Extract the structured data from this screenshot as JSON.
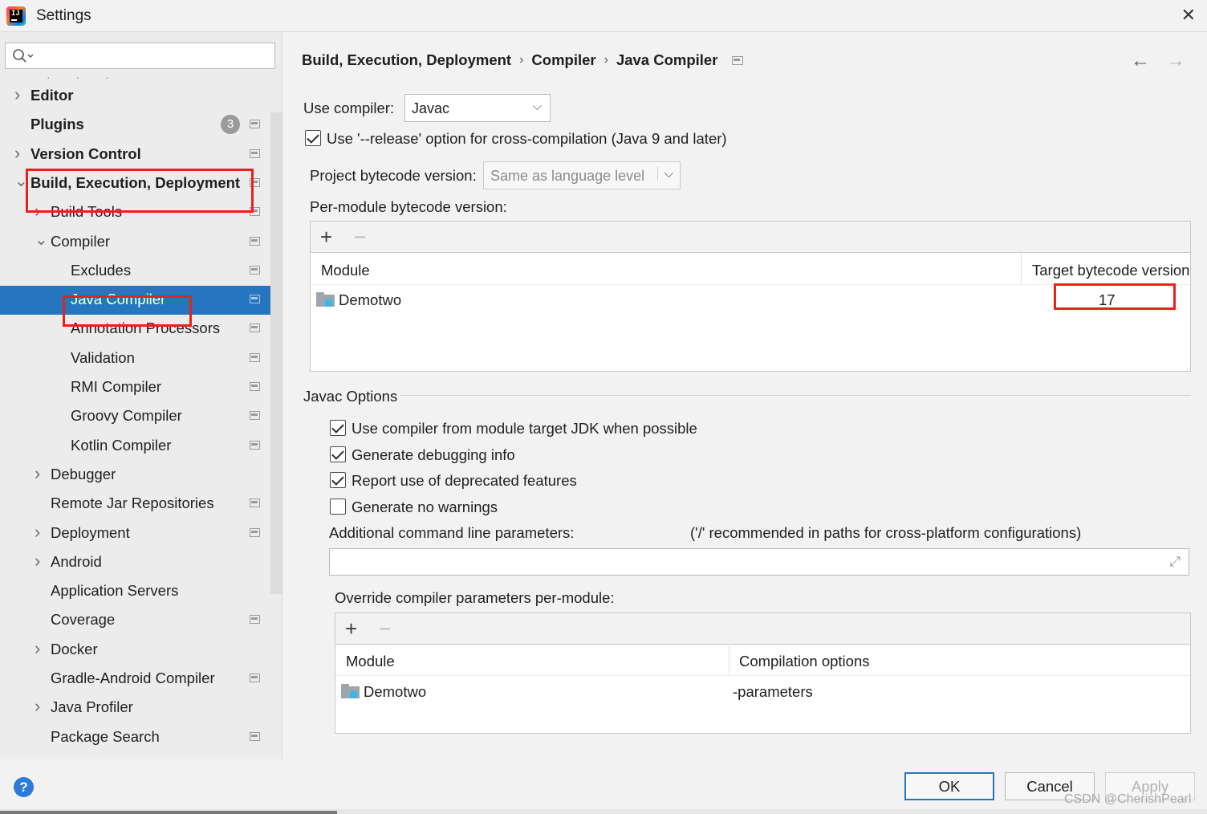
{
  "window": {
    "title": "Settings",
    "close_label": "✕"
  },
  "search": {
    "placeholder": "",
    "value": ""
  },
  "sidebar": {
    "items": [
      {
        "label": "Editor",
        "indent": 0,
        "bold": true,
        "arrow": "right"
      },
      {
        "label": "Plugins",
        "indent": 0,
        "bold": true,
        "badge": "3"
      },
      {
        "label": "Version Control",
        "indent": 0,
        "bold": true,
        "arrow": "right"
      },
      {
        "label": "Build, Execution, Deployment",
        "indent": 0,
        "bold": true,
        "arrow": "down"
      },
      {
        "label": "Build Tools",
        "indent": 1,
        "arrow": "right"
      },
      {
        "label": "Compiler",
        "indent": 1,
        "arrow": "down"
      },
      {
        "label": "Excludes",
        "indent": 2
      },
      {
        "label": "Java Compiler",
        "indent": 2,
        "selected": true
      },
      {
        "label": "Annotation Processors",
        "indent": 2
      },
      {
        "label": "Validation",
        "indent": 2
      },
      {
        "label": "RMI Compiler",
        "indent": 2
      },
      {
        "label": "Groovy Compiler",
        "indent": 2
      },
      {
        "label": "Kotlin Compiler",
        "indent": 2
      },
      {
        "label": "Debugger",
        "indent": 1,
        "arrow": "right"
      },
      {
        "label": "Remote Jar Repositories",
        "indent": 1
      },
      {
        "label": "Deployment",
        "indent": 1,
        "arrow": "right"
      },
      {
        "label": "Android",
        "indent": 1,
        "arrow": "right"
      },
      {
        "label": "Application Servers",
        "indent": 1
      },
      {
        "label": "Coverage",
        "indent": 1
      },
      {
        "label": "Docker",
        "indent": 1,
        "arrow": "right"
      },
      {
        "label": "Gradle-Android Compiler",
        "indent": 1
      },
      {
        "label": "Java Profiler",
        "indent": 1,
        "arrow": "right"
      },
      {
        "label": "Package Search",
        "indent": 1
      }
    ]
  },
  "breadcrumb": [
    "Build, Execution, Deployment",
    "Compiler",
    "Java Compiler"
  ],
  "nav": {
    "back": "←",
    "forward": "→"
  },
  "use_compiler": {
    "label": "Use compiler:",
    "value": "Javac"
  },
  "release_option": {
    "label": "Use '--release' option for cross-compilation (Java 9 and later)",
    "checked": true
  },
  "project_bytecode": {
    "label": "Project bytecode version:",
    "placeholder": "Same as language level"
  },
  "per_module": {
    "label": "Per-module bytecode version:",
    "columns": [
      "Module",
      "Target bytecode version"
    ],
    "rows": [
      {
        "module": "Demotwo",
        "version": "17"
      }
    ]
  },
  "javac_options": {
    "title": "Javac Options",
    "checkboxes": [
      {
        "label": "Use compiler from module target JDK when possible",
        "checked": true
      },
      {
        "label": "Generate debugging info",
        "checked": true
      },
      {
        "label": "Report use of deprecated features",
        "checked": true
      },
      {
        "label": "Generate no warnings",
        "checked": false
      }
    ],
    "additional_params_label": "Additional command line parameters:",
    "additional_params_hint": "('/' recommended in paths for cross-platform configurations)",
    "additional_params_value": "",
    "override_label": "Override compiler parameters per-module:",
    "override_columns": [
      "Module",
      "Compilation options"
    ],
    "override_rows": [
      {
        "module": "Demotwo",
        "options": "-parameters"
      }
    ]
  },
  "toolbar": {
    "add": "+",
    "remove": "−"
  },
  "buttons": {
    "ok": "OK",
    "cancel": "Cancel",
    "apply": "Apply",
    "help": "?"
  },
  "watermark": "CSDN @CherishPearl",
  "colors": {
    "selection": "#2675bf",
    "highlight_box": "#e8221b",
    "help": "#2d7ad8"
  }
}
